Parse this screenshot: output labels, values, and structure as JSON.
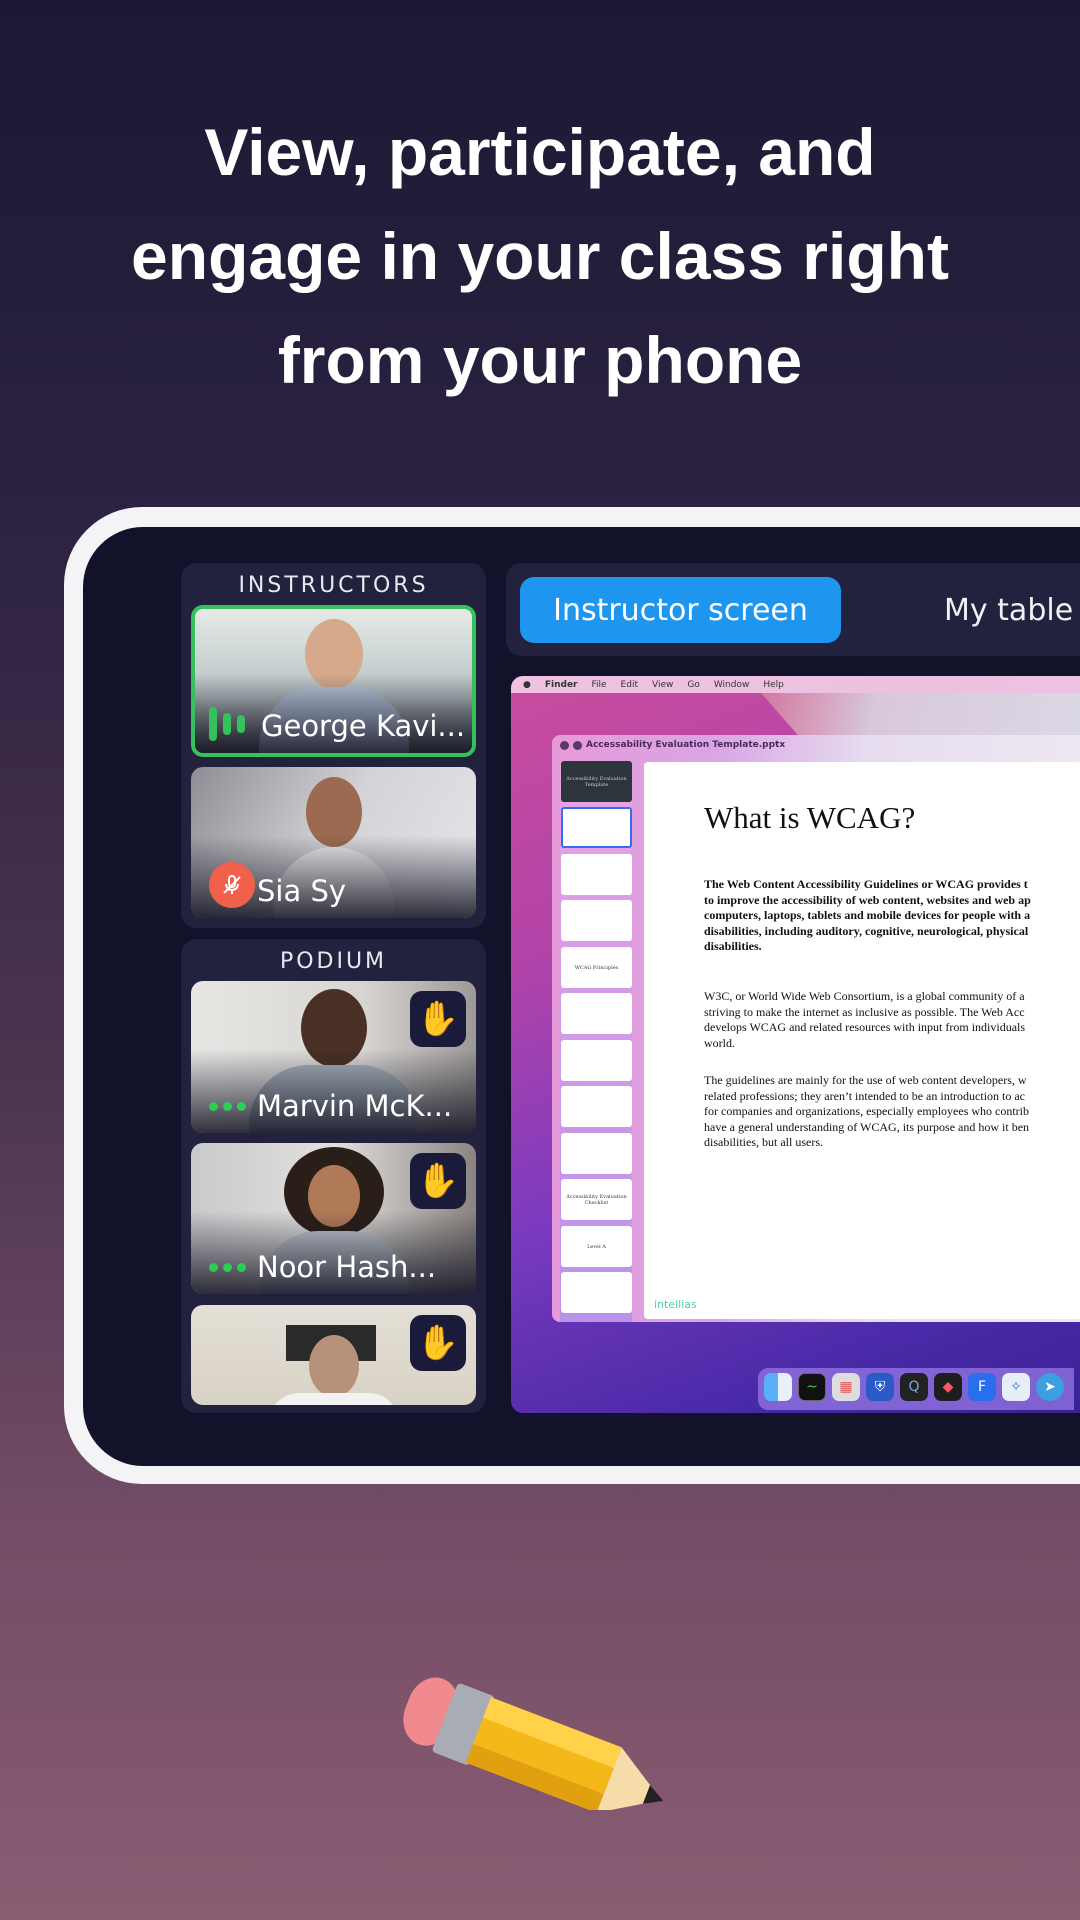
{
  "headline": {
    "line1": "View, participate, and",
    "line2": "engage in your class right",
    "line3": "from your phone"
  },
  "instructors": {
    "title": "INSTRUCTORS",
    "participants": [
      {
        "name": "George Kavi...",
        "status": "speaking"
      },
      {
        "name": "Sia Sy",
        "status": "muted"
      }
    ]
  },
  "podium": {
    "title": "PODIUM",
    "participants": [
      {
        "name": "Marvin McK...",
        "hand_raised": true
      },
      {
        "name": "Noor Hash...",
        "hand_raised": true
      },
      {
        "name": "",
        "hand_raised": true
      }
    ]
  },
  "tabs": [
    {
      "label": "Instructor screen",
      "active": true
    },
    {
      "label": "My table",
      "active": false
    }
  ],
  "shared_screen": {
    "menubar": [
      "Finder",
      "File",
      "Edit",
      "View",
      "Go",
      "Window",
      "Help"
    ],
    "window_title": "Accessability Evaluation Template.pptx",
    "thumbnails": [
      "Accessibility Evaluation Template",
      "",
      "",
      "",
      "WCAG Principles",
      "",
      "",
      "",
      "",
      "Accessibility Evaluation Checklist",
      "Level A",
      ""
    ],
    "slide": {
      "title": "What is WCAG?",
      "bold_paragraph": "The Web Content Accessibility Guidelines or WCAG provides t\nto improve the accessibility of web content, websites and web ap\ncomputers, laptops, tablets and mobile devices for people with a\ndisabilities, including auditory, cognitive, neurological, physical\ndisabilities.",
      "paragraph2": "W3C, or World Wide Web Consortium, is a global community of a\nstriving to make the internet as inclusive as possible. The Web Acc\ndevelops WCAG and related resources with input from individuals\nworld.",
      "paragraph3": "The guidelines are mainly for the use of web content developers, w\nrelated professions; they aren’t intended to be an introduction to ac\nfor companies and organizations, especially employees who contrib\nhave a general understanding of WCAG, its purpose and how it ben\ndisabilities, but all users.",
      "logo": "intellias"
    },
    "dock_apps": [
      "finder",
      "activity-monitor",
      "launchpad",
      "shield-vpn",
      "quicktime",
      "figma",
      "framer",
      "safari",
      "telegram"
    ]
  },
  "colors": {
    "accent": "#1e96f0",
    "speaking": "#2ecc55",
    "muted": "#f0604a"
  }
}
